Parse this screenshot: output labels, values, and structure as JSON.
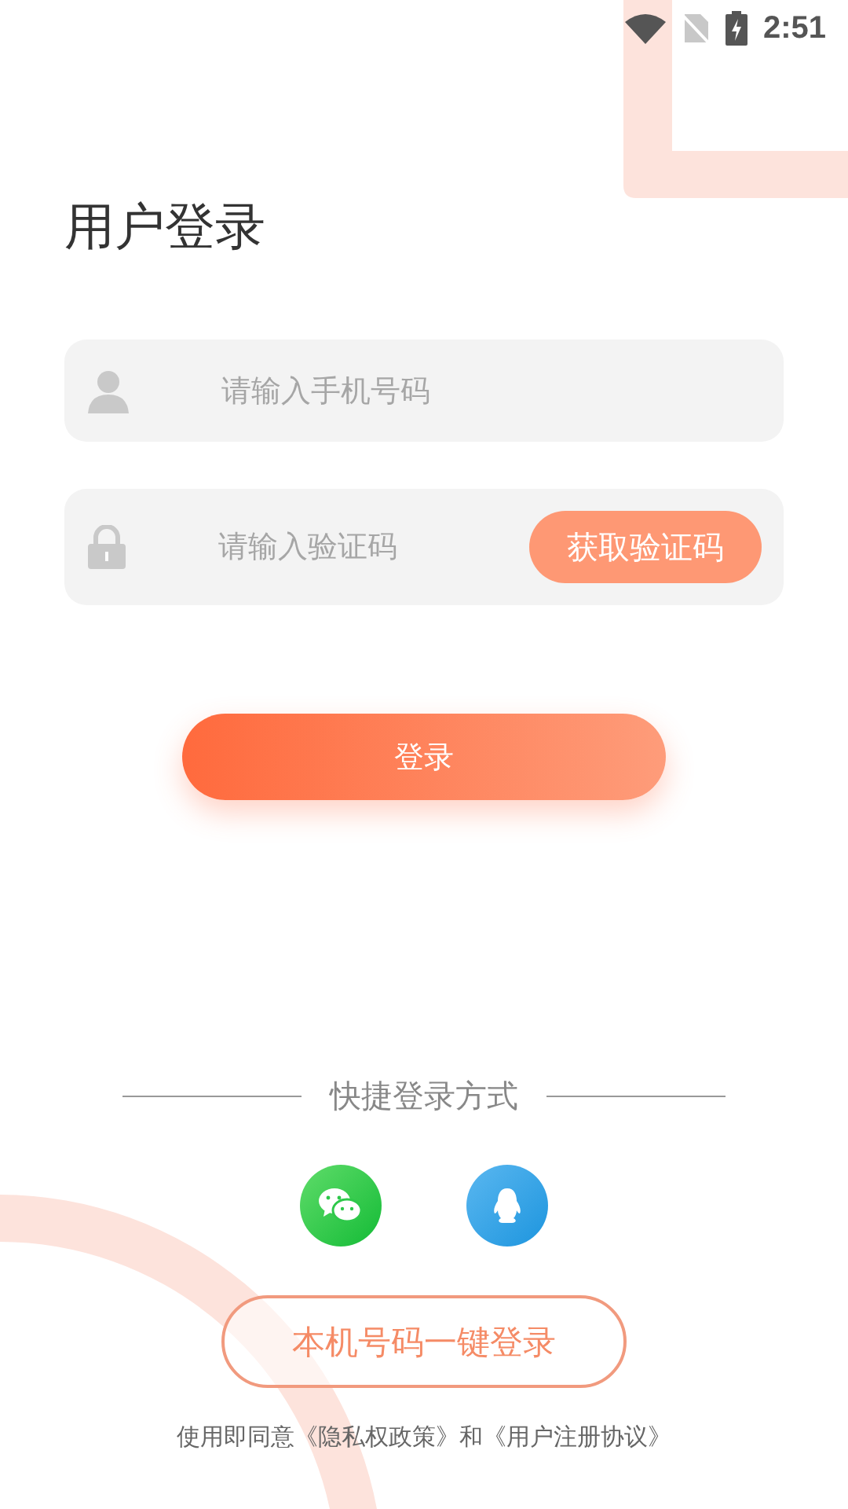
{
  "status_bar": {
    "time": "2:51"
  },
  "title": "用户登录",
  "phone_field": {
    "placeholder": "请输入手机号码"
  },
  "code_field": {
    "placeholder": "请输入验证码",
    "button": "获取验证码"
  },
  "login_button": "登录",
  "quick_login": {
    "label": "快捷登录方式",
    "options": [
      {
        "kind": "wechat"
      },
      {
        "kind": "qq"
      }
    ]
  },
  "one_click_button": "本机号码一键登录",
  "agreement": "使用即同意《隐私权政策》和《用户注册协议》"
}
